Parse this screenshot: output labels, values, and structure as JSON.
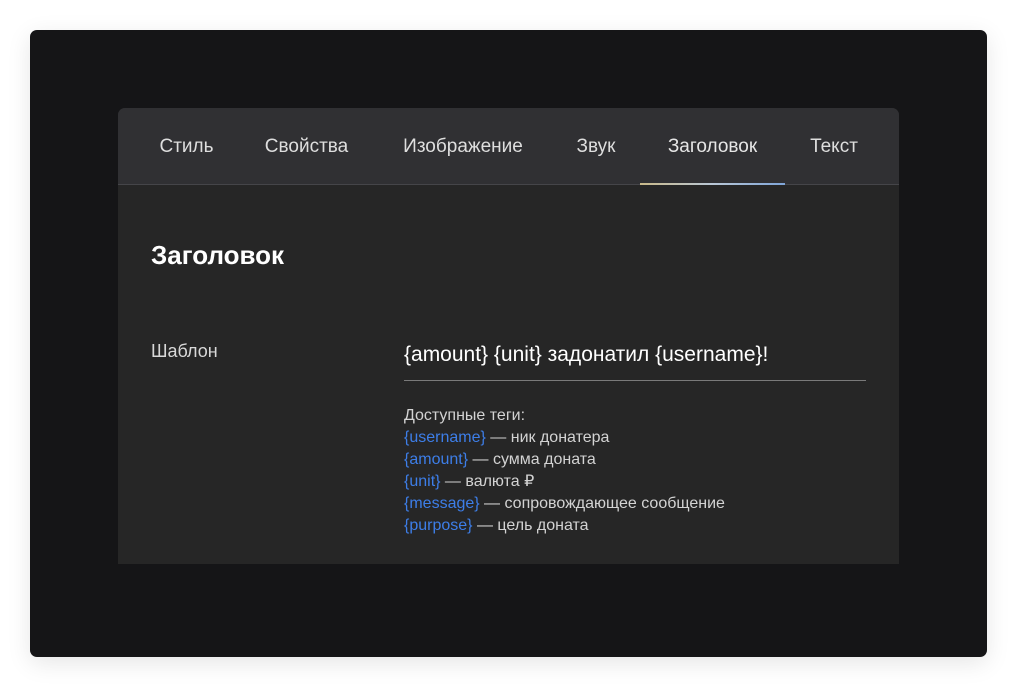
{
  "tabs": [
    {
      "label": "Стиль"
    },
    {
      "label": "Свойства"
    },
    {
      "label": "Изображение"
    },
    {
      "label": "Звук"
    },
    {
      "label": "Заголовок"
    },
    {
      "label": "Текст"
    }
  ],
  "active_tab": "Заголовок",
  "section": {
    "title": "Заголовок"
  },
  "template": {
    "label": "Шаблон",
    "value": "{amount} {unit} задонатил {username}!"
  },
  "tags": {
    "heading": "Доступные теги:",
    "items": [
      {
        "tag": "{username}",
        "desc": " — ник донатера"
      },
      {
        "tag": "{amount}",
        "desc": " — сумма доната"
      },
      {
        "tag": "{unit}",
        "desc": " — валюта ₽"
      },
      {
        "tag": "{message}",
        "desc": " — сопровождающее сообщение"
      },
      {
        "tag": "{purpose}",
        "desc": " — цель доната"
      }
    ]
  },
  "colors": {
    "page_background": "#151517",
    "panel_background": "#262626",
    "tabbar_background": "#303033",
    "tag_link": "#3d7ee8"
  }
}
